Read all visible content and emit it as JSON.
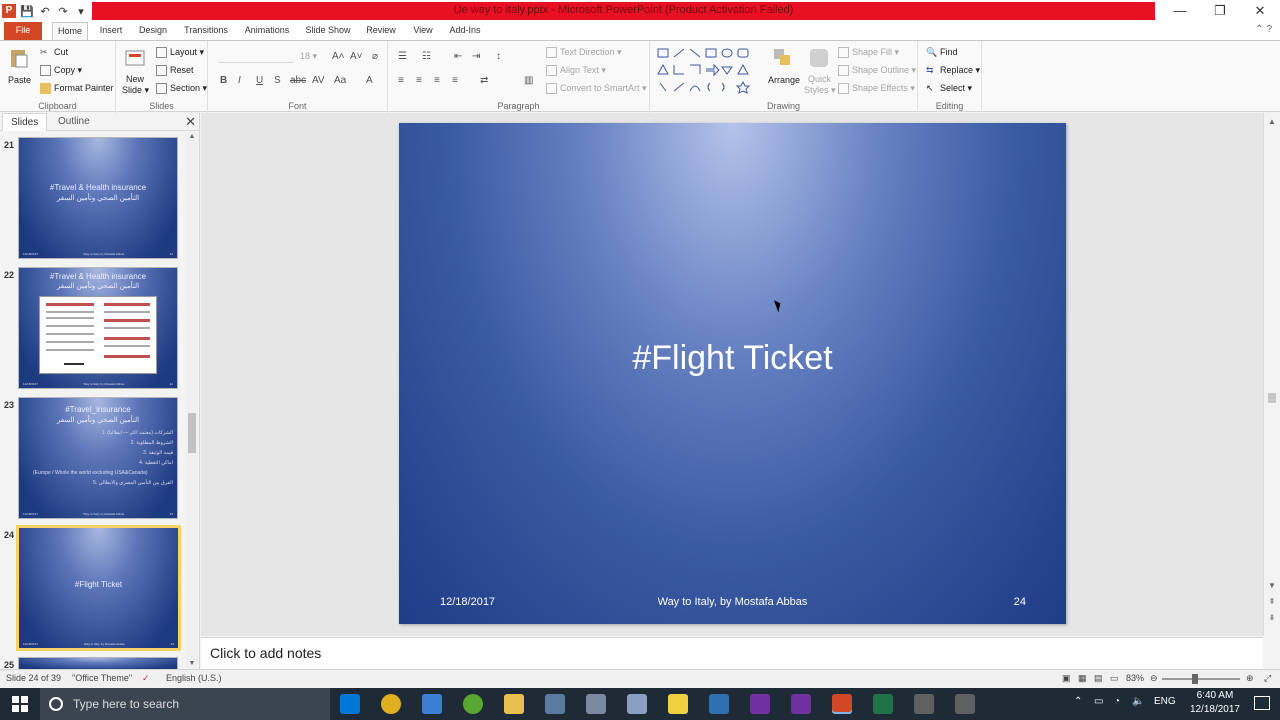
{
  "window": {
    "title": "Ue way to italy.pptx - Microsoft PowerPoint (Product Activation Failed)",
    "controls": {
      "minimize": "—",
      "maximize": "❐",
      "close": "✕"
    }
  },
  "qat": {
    "logo": "P",
    "save": "💾",
    "undo": "↶",
    "redo": "↷",
    "customize": "▾"
  },
  "tabs": [
    {
      "label": "File"
    },
    {
      "label": "Home"
    },
    {
      "label": "Insert"
    },
    {
      "label": "Design"
    },
    {
      "label": "Transitions"
    },
    {
      "label": "Animations"
    },
    {
      "label": "Slide Show"
    },
    {
      "label": "Review"
    },
    {
      "label": "View"
    },
    {
      "label": "Add-Ins"
    }
  ],
  "ribbon": {
    "clipboard": {
      "label": "Clipboard",
      "paste": "Paste",
      "cut": "Cut",
      "copy": "Copy ▾",
      "format_painter": "Format Painter"
    },
    "slides": {
      "label": "Slides",
      "new_slide": "New",
      "new_slide2": "Slide ▾",
      "layout": "Layout ▾",
      "reset": "Reset",
      "section": "Section ▾"
    },
    "font": {
      "label": "Font",
      "size": "18"
    },
    "paragraph": {
      "label": "Paragraph",
      "text_direction": "Text Direction ▾",
      "align_text": "Align Text ▾",
      "convert_smartart": "Convert to SmartArt ▾"
    },
    "drawing": {
      "label": "Drawing",
      "arrange": "Arrange",
      "quick_styles": "Quick",
      "quick_styles2": "Styles ▾",
      "shape_fill": "Shape Fill ▾",
      "shape_outline": "Shape Outline ▾",
      "shape_effects": "Shape Effects ▾"
    },
    "editing": {
      "label": "Editing",
      "find": "Find",
      "replace": "Replace ▾",
      "select": "Select ▾"
    }
  },
  "left_pane": {
    "tab_slides": "Slides",
    "tab_outline": "Outline",
    "close": "✕",
    "slides": [
      {
        "num": "21",
        "title": "#Travel & Health insurance",
        "subtitle": "التأمين الصحي وتأمين السفر",
        "foot_date": "12/18/2017",
        "foot_mid": "Way to Italy, by Mostafa Abbas",
        "foot_num": "21"
      },
      {
        "num": "22",
        "title": "#Travel & Health insurance",
        "subtitle": "التأمين الصحي وتأمين السفر",
        "foot_date": "12/18/2017",
        "foot_mid": "Way to Italy, by Mostafa Abbas",
        "foot_num": "22"
      },
      {
        "num": "23",
        "title": "#Travel_insurance",
        "subtitle": "التأمين الصحي وتأمين السفر",
        "foot_date": "12/18/2017",
        "foot_mid": "Way to Italy, by Mostafa Abbas",
        "foot_num": "23",
        "bullets": [
          "1. الشركات (معتمد اكثر — ايطاليا)",
          "2. الشروط المطلوبة",
          "3. قيمة الوثيقة",
          "4. اماكن التغطية",
          "(Europe / Whole the world excluding USA&Canada)",
          "5. الفرق بين التأمين المصري والايطالي"
        ]
      },
      {
        "num": "24",
        "title": "#Flight Ticket",
        "foot_date": "12/18/2017",
        "foot_mid": "Way to Italy, by Mostafa Abbas",
        "foot_num": "24"
      },
      {
        "num": "25"
      }
    ]
  },
  "slide": {
    "title": "#Flight Ticket",
    "date": "12/18/2017",
    "footer": "Way to Italy, by Mostafa Abbas",
    "number": "24"
  },
  "notes": {
    "placeholder": "Click to add notes"
  },
  "status": {
    "slide_of": "Slide 24 of 39",
    "theme": "\"Office Theme\"",
    "language": "English (U.S.)",
    "zoom": "83%",
    "zoom_fraction": 0.415
  },
  "taskbar": {
    "search_placeholder": "Type here to search",
    "time": "6:40 AM",
    "date": "12/18/2017",
    "lang": "ENG",
    "apps": [
      "edge-icon",
      "chrome-icon",
      "store-icon",
      "utorrent-icon",
      "explorer-icon",
      "app-icon",
      "app2-icon",
      "app3-icon",
      "sticky-notes-icon",
      "calc-icon",
      "onenote-icon",
      "onenote2-icon",
      "powerpoint-icon",
      "excel-icon",
      "app4-icon",
      "app5-icon"
    ]
  },
  "colors": {
    "titlebar": "#e81123",
    "file_tab": "#d24726",
    "slide_dark": "#1f3c86",
    "slide_light": "#b4c3ea",
    "selected_thumb": "#f6d264"
  }
}
